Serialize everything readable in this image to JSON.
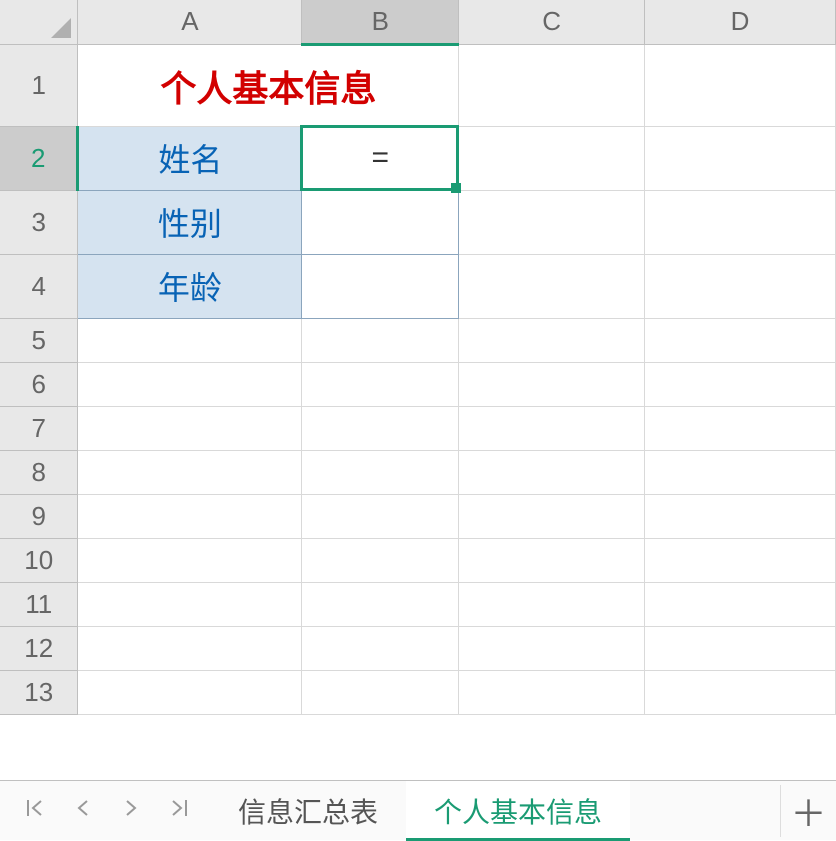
{
  "columns": [
    "A",
    "B",
    "C",
    "D"
  ],
  "rows": [
    "1",
    "2",
    "3",
    "4",
    "5",
    "6",
    "7",
    "8",
    "9",
    "10",
    "11",
    "12",
    "13"
  ],
  "active_column": "B",
  "active_row": "2",
  "cells": {
    "A1_merged": {
      "value": "个人基本信息",
      "type": "title"
    },
    "A2": {
      "value": "姓名",
      "type": "label"
    },
    "B2": {
      "value": "=",
      "type": "value"
    },
    "A3": {
      "value": "性别",
      "type": "label"
    },
    "B3": {
      "value": "",
      "type": "value"
    },
    "A4": {
      "value": "年龄",
      "type": "label"
    },
    "B4": {
      "value": "",
      "type": "value"
    }
  },
  "tabs": {
    "items": [
      {
        "label": "信息汇总表",
        "active": false
      },
      {
        "label": "个人基本信息",
        "active": true
      }
    ],
    "add_icon": "＋"
  },
  "nav": {
    "first": "|‹",
    "prev": "‹",
    "next": "›",
    "last": "›|"
  }
}
